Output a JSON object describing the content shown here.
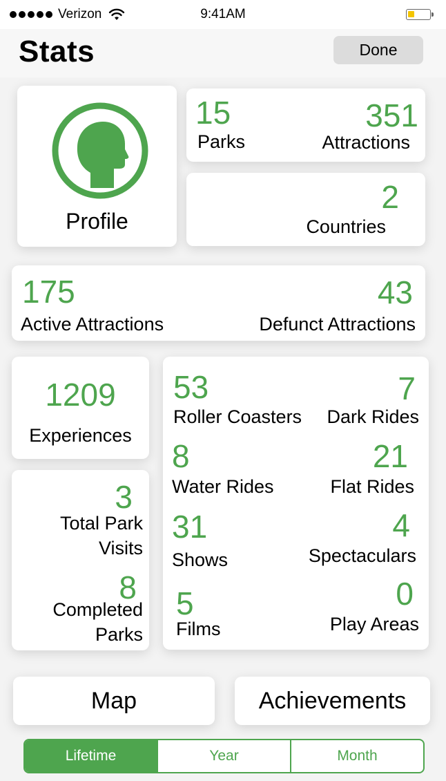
{
  "status_bar": {
    "carrier": "Verizon",
    "time": "9:41AM"
  },
  "header": {
    "title": "Stats",
    "done_label": "Done"
  },
  "profile": {
    "label": "Profile"
  },
  "summary": {
    "parks": {
      "value": "15",
      "label": "Parks"
    },
    "attractions": {
      "value": "351",
      "label": "Attractions"
    },
    "countries": {
      "value": "2",
      "label": "Countries"
    },
    "active_attractions": {
      "value": "175",
      "label": "Active Attractions"
    },
    "defunct_attractions": {
      "value": "43",
      "label": "Defunct Attractions"
    }
  },
  "experiences": {
    "value": "1209",
    "label": "Experiences"
  },
  "visits": {
    "total_park_visits": {
      "value": "3",
      "label_line1": "Total Park",
      "label_line2": "Visits"
    },
    "completed_parks": {
      "value": "8",
      "label_line1": "Completed",
      "label_line2": "Parks"
    }
  },
  "categories": {
    "roller_coasters": {
      "value": "53",
      "label": "Roller Coasters"
    },
    "dark_rides": {
      "value": "7",
      "label": "Dark Rides"
    },
    "water_rides": {
      "value": "8",
      "label": "Water Rides"
    },
    "flat_rides": {
      "value": "21",
      "label": "Flat Rides"
    },
    "shows": {
      "value": "31",
      "label": "Shows"
    },
    "spectaculars": {
      "value": "4",
      "label": "Spectaculars"
    },
    "films": {
      "value": "5",
      "label": "Films"
    },
    "play_areas": {
      "value": "0",
      "label": "Play Areas"
    }
  },
  "buttons": {
    "map": "Map",
    "achievements": "Achievements"
  },
  "period_selector": {
    "options": [
      "Lifetime",
      "Year",
      "Month"
    ],
    "selected": "Lifetime"
  },
  "colors": {
    "accent": "#4ea54e",
    "done_button": "#dcdcdc",
    "battery": "#f4c500"
  },
  "icons": {
    "profile": "head-silhouette-icon",
    "wifi": "wifi-icon",
    "battery": "battery-icon",
    "signal": "signal-dots-icon"
  }
}
